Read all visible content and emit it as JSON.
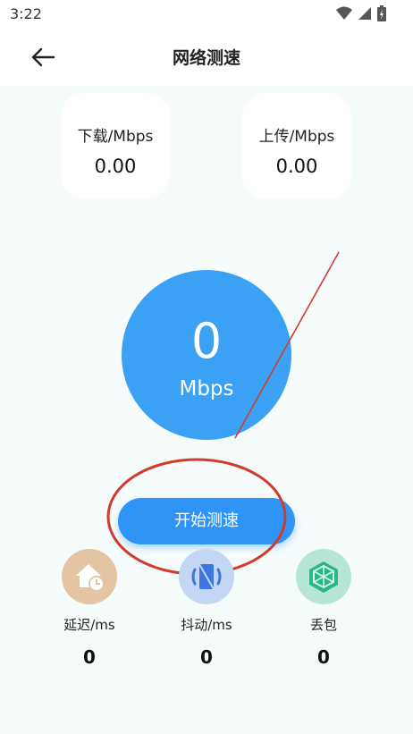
{
  "status_bar": {
    "time": "3:22"
  },
  "header": {
    "title": "网络测速"
  },
  "download": {
    "label": "下载/Mbps",
    "value": "0.00"
  },
  "upload": {
    "label": "上传/Mbps",
    "value": "0.00"
  },
  "speed": {
    "value": "0",
    "unit": "Mbps"
  },
  "start_button": {
    "label": "开始测速"
  },
  "metrics": [
    {
      "label": "延迟/ms",
      "value": "0",
      "icon": "home-clock-icon",
      "bg": "#e4c4a2"
    },
    {
      "label": "抖动/ms",
      "value": "0",
      "icon": "jitter-icon",
      "bg": "#c4d6f3"
    },
    {
      "label": "丢包",
      "value": "0",
      "icon": "package-icon",
      "bg": "#b8e6d4"
    }
  ],
  "colors": {
    "accent": "#2e95f7",
    "circle": "#3aa1f5",
    "annotation": "#d23a2a"
  }
}
